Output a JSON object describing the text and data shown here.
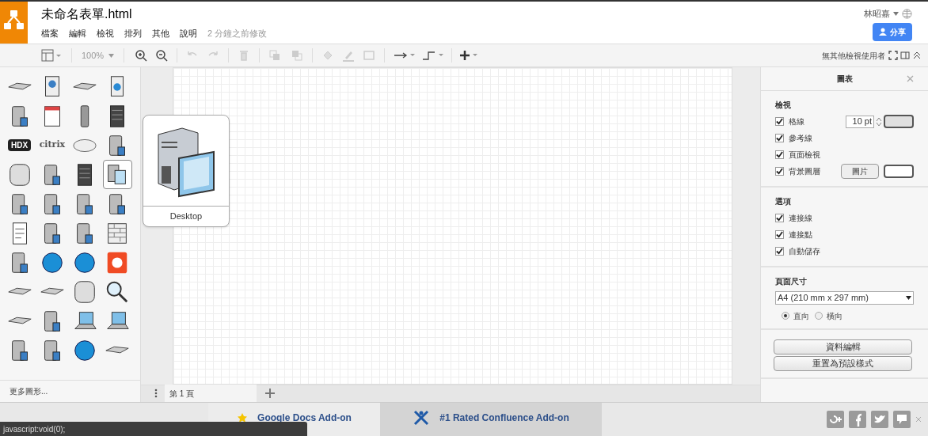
{
  "header": {
    "title": "未命名表單.html",
    "menus": [
      "檔案",
      "編輯",
      "檢視",
      "排列",
      "其他",
      "說明"
    ],
    "last_modified": "2 分鐘之前修改",
    "user": "林昭嘉",
    "share_button": "分享"
  },
  "toolbar": {
    "zoom": "100%",
    "viewers": "無其他檢視使用者"
  },
  "shapes": [
    {
      "kind": "flat",
      "selected": false
    },
    {
      "kind": "badge",
      "selected": false
    },
    {
      "kind": "flat",
      "selected": false
    },
    {
      "kind": "card",
      "selected": false
    },
    {
      "kind": "server",
      "selected": false
    },
    {
      "kind": "calendar",
      "selected": false
    },
    {
      "kind": "phone",
      "selected": false
    },
    {
      "kind": "rack",
      "selected": false
    },
    {
      "kind": "logo",
      "label": "HDX",
      "selected": false
    },
    {
      "kind": "text",
      "label": "citrix",
      "selected": false
    },
    {
      "kind": "cloud",
      "selected": false
    },
    {
      "kind": "server",
      "selected": false
    },
    {
      "kind": "database",
      "selected": false
    },
    {
      "kind": "server",
      "selected": false
    },
    {
      "kind": "rack",
      "selected": false
    },
    {
      "kind": "desktop",
      "selected": true
    },
    {
      "kind": "server",
      "selected": false
    },
    {
      "kind": "server",
      "selected": false
    },
    {
      "kind": "server",
      "selected": false
    },
    {
      "kind": "server",
      "selected": false
    },
    {
      "kind": "doc",
      "selected": false
    },
    {
      "kind": "server",
      "selected": false
    },
    {
      "kind": "server",
      "selected": false
    },
    {
      "kind": "firewall",
      "selected": false
    },
    {
      "kind": "server",
      "selected": false
    },
    {
      "kind": "globe",
      "selected": false
    },
    {
      "kind": "globe",
      "selected": false
    },
    {
      "kind": "flower",
      "selected": false
    },
    {
      "kind": "flat",
      "selected": false
    },
    {
      "kind": "flat",
      "selected": false
    },
    {
      "kind": "database",
      "selected": false
    },
    {
      "kind": "magnifier",
      "selected": false
    },
    {
      "kind": "flat",
      "selected": false
    },
    {
      "kind": "server",
      "selected": false
    },
    {
      "kind": "laptop",
      "selected": false
    },
    {
      "kind": "laptop",
      "selected": false
    },
    {
      "kind": "server",
      "selected": false
    },
    {
      "kind": "server",
      "selected": false
    },
    {
      "kind": "globe",
      "selected": false
    },
    {
      "kind": "flat",
      "selected": false
    }
  ],
  "more_shapes": "更多圖形...",
  "tooltip": {
    "label": "Desktop"
  },
  "page_tab": "第 1 頁",
  "panel": {
    "title": "圖表",
    "sections": [
      {
        "title": "檢視",
        "items": [
          {
            "kind": "number",
            "label": "格線",
            "checked": true,
            "value": "10 pt",
            "color": "#e0e0e0"
          },
          {
            "kind": "check",
            "label": "參考線",
            "checked": true
          },
          {
            "kind": "check",
            "label": "頁面檢視",
            "checked": true
          },
          {
            "kind": "image",
            "label": "背景圖層",
            "checked": true,
            "button": "圖片",
            "color": "#ffffff"
          }
        ]
      },
      {
        "title": "選項",
        "items": [
          {
            "kind": "check",
            "label": "連接線",
            "checked": true
          },
          {
            "kind": "check",
            "label": "連接點",
            "checked": true
          },
          {
            "kind": "check",
            "label": "自動儲存",
            "checked": true
          }
        ]
      }
    ],
    "page_size": {
      "title": "頁面尺寸",
      "value": "A4 (210 mm x 297 mm)",
      "orientations": [
        {
          "label": "直向",
          "selected": true
        },
        {
          "label": "橫向",
          "selected": false
        }
      ]
    },
    "buttons": [
      "資料編輯",
      "重置為預設樣式"
    ]
  },
  "ads": [
    {
      "label": "Google Docs Add-on",
      "selected": false
    },
    {
      "label": "#1 Rated Confluence Add-on",
      "selected": true
    }
  ],
  "status_text": "javascript:void(0);"
}
